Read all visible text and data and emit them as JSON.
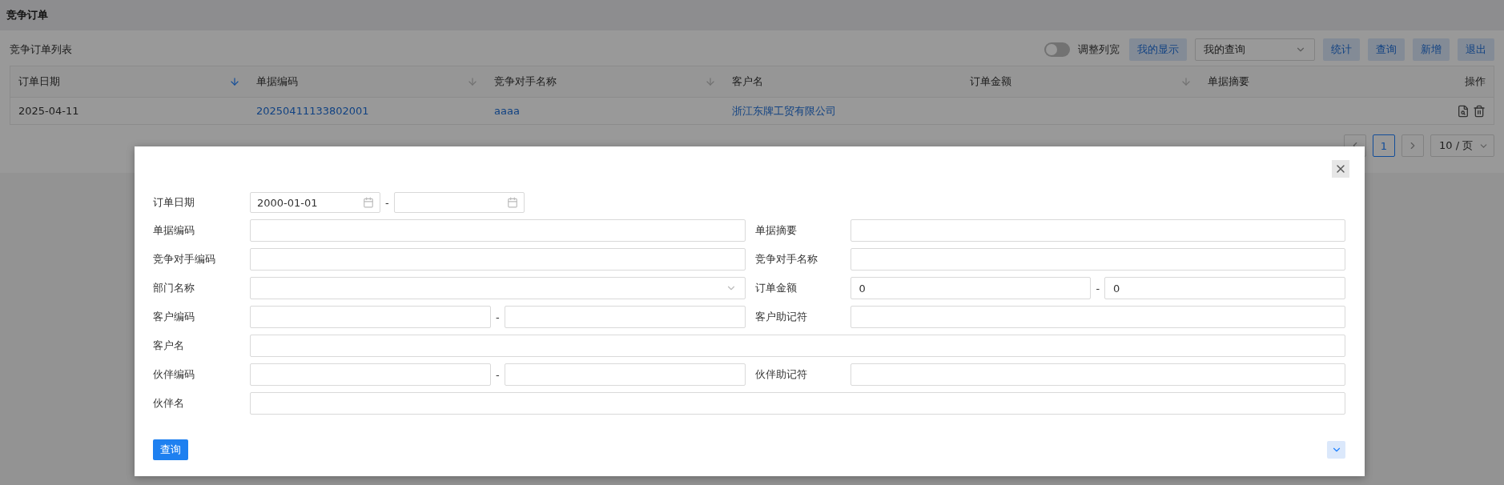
{
  "page": {
    "title": "竞争订单"
  },
  "list": {
    "title": "竞争订单列表",
    "toggle": {
      "label": "调整列宽",
      "on": false
    },
    "buttons": [
      {
        "label": "我的显示",
        "kind": "button"
      },
      {
        "label": "我的查询",
        "kind": "dropdown"
      },
      {
        "label": "统计",
        "kind": "button"
      },
      {
        "label": "查询",
        "kind": "button"
      },
      {
        "label": "新增",
        "kind": "button"
      },
      {
        "label": "退出",
        "kind": "button"
      }
    ]
  },
  "table": {
    "columns": [
      {
        "label": "订单日期",
        "sorted": true
      },
      {
        "label": "单据编码",
        "sorted": false
      },
      {
        "label": "竞争对手名称",
        "sorted": false
      },
      {
        "label": "客户名"
      },
      {
        "label": "订单金额",
        "sorted": false
      },
      {
        "label": "单据摘要"
      },
      {
        "label": "操作"
      }
    ],
    "rows": [
      {
        "cells": [
          {
            "text": "2025-04-11",
            "link": false
          },
          {
            "text": "20250411133802001",
            "link": true
          },
          {
            "text": "aaaa",
            "link": true
          },
          {
            "text": "浙江东牌工贸有限公司",
            "link": true
          }
        ]
      }
    ]
  },
  "pagination": {
    "pages": [
      {
        "label": "1",
        "selected": true
      }
    ],
    "page_size": "10 / 页"
  },
  "dialog": {
    "fields": [
      {
        "label": "订单日期",
        "kind": "date_range",
        "from": "2000-01-01",
        "separator": "-"
      },
      {
        "label": "单据编码",
        "kind": "text"
      },
      {
        "label": "单据摘要",
        "kind": "text"
      },
      {
        "label": "竞争对手编码",
        "kind": "text"
      },
      {
        "label": "竞争对手名称",
        "kind": "text"
      },
      {
        "label": "部门名称",
        "kind": "select"
      },
      {
        "label": "订单金额",
        "kind": "range",
        "from": "0",
        "to": "0",
        "separator": "-"
      },
      {
        "label": "客户编码",
        "kind": "range",
        "separator": "-"
      },
      {
        "label": "客户助记符",
        "kind": "text"
      },
      {
        "label": "客户名",
        "kind": "text",
        "wide": true
      },
      {
        "label": "伙伴编码",
        "kind": "range",
        "separator": "-"
      },
      {
        "label": "伙伴助记符",
        "kind": "text"
      },
      {
        "label": "伙伴名",
        "kind": "text",
        "wide": true
      }
    ],
    "submit": "查询"
  }
}
